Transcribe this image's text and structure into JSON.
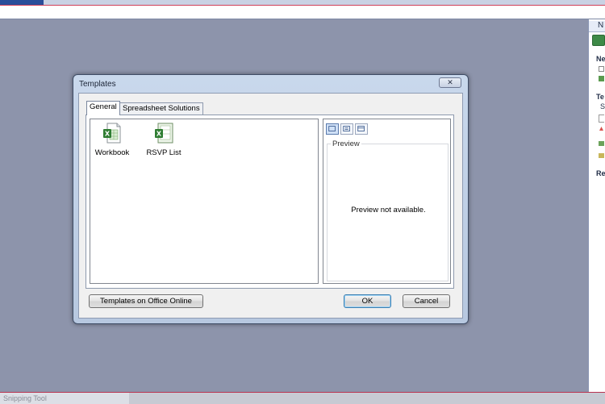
{
  "dialog": {
    "title": "Templates",
    "close_glyph": "✕",
    "tabs": [
      {
        "label": "General",
        "active": true
      },
      {
        "label": "Spreadsheet Solutions",
        "active": false
      }
    ],
    "templates": [
      {
        "label": "Workbook",
        "icon": "excel-workbook-icon"
      },
      {
        "label": "RSVP List",
        "icon": "excel-template-icon"
      }
    ],
    "view_buttons": [
      "large-icons-view",
      "list-view",
      "details-view"
    ],
    "preview": {
      "label": "Preview",
      "message": "Preview not available."
    },
    "buttons": {
      "online": "Templates on Office Online",
      "ok": "OK",
      "cancel": "Cancel"
    }
  },
  "taskbar": {
    "snipping_tool": "Snipping Tool"
  },
  "task_pane": {
    "title_fragment": "N",
    "heading_new": "Ne",
    "heading_templates": "Te",
    "heading_recent": "Re",
    "fragment_s": "S"
  },
  "colors": {
    "desktop": "#8d94ab",
    "dialog_frame": "#c9d8ec",
    "excel_green": "#3e8a47",
    "accent_red": "#d0405a"
  }
}
